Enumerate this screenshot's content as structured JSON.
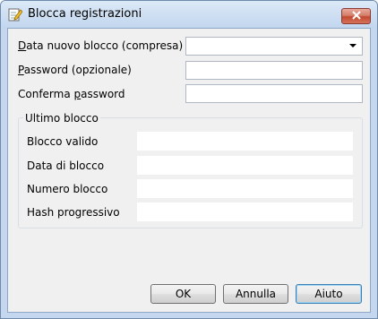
{
  "window": {
    "title": "Blocca registrazioni"
  },
  "form": {
    "date_label_prefix": "",
    "date_label_mnemonic": "D",
    "date_label_rest": "ata nuovo blocco (compresa)",
    "date_value": "",
    "password_label_mnemonic": "P",
    "password_label_rest": "assword (opzionale)",
    "password_value": "",
    "confirm_label_prefix": "Conferma ",
    "confirm_label_mnemonic": "p",
    "confirm_label_rest": "assword",
    "confirm_value": ""
  },
  "last_block": {
    "title": "Ultimo blocco",
    "fields": [
      {
        "label": "Blocco valido",
        "value": ""
      },
      {
        "label": "Data di blocco",
        "value": ""
      },
      {
        "label": "Numero blocco",
        "value": ""
      },
      {
        "label": "Hash progressivo",
        "value": ""
      }
    ]
  },
  "buttons": {
    "ok": "OK",
    "cancel": "Annulla",
    "help": "Aiuto"
  },
  "icons": {
    "app": "edit-document-icon",
    "close": "close-icon",
    "dropdown": "chevron-down-icon"
  }
}
